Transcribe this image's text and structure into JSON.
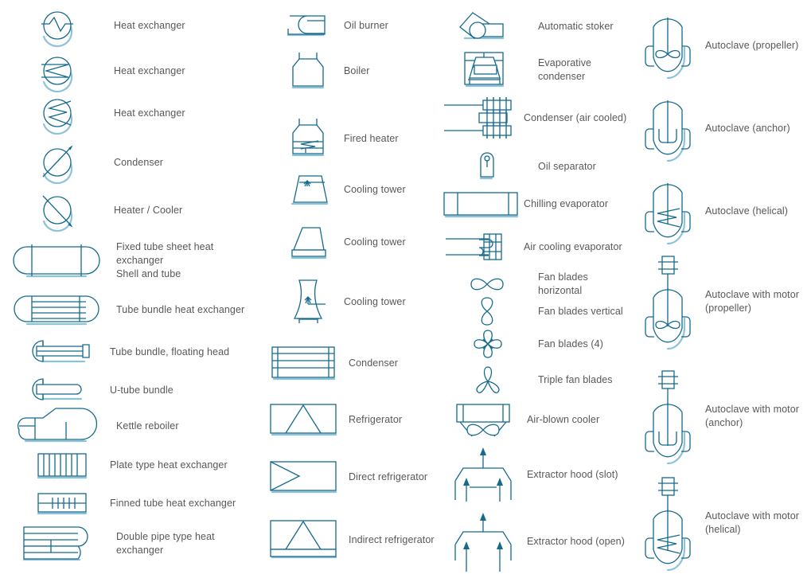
{
  "page": {
    "title": "Chemical and Process Engineering — Heat Exchangers and Vessels stencil",
    "background_color": "#ffffff",
    "symbol_line_color": "#156a8e",
    "symbol_shadow_color": "#8cc3da",
    "label_text_color": "#58585a"
  },
  "columns": [
    {
      "name": "column-heat-exchangers",
      "items": [
        {
          "icon": "heat-exchanger-zigzag-circle-icon",
          "label": "Heat exchanger"
        },
        {
          "icon": "heat-exchanger-arrow-circle-icon",
          "label": "Heat exchanger"
        },
        {
          "icon": "heat-exchanger-coil-circle-icon",
          "label": "Heat exchanger"
        },
        {
          "icon": "condenser-circle-arrow-icon",
          "label": "Condenser"
        },
        {
          "icon": "heater-cooler-circle-arrow-icon",
          "label": "Heater / Cooler"
        },
        {
          "icon": "fixed-tube-sheet-heat-exchanger-icon",
          "label": "Fixed tube sheet heat exchanger\nShell and tube"
        },
        {
          "icon": "tube-bundle-heat-exchanger-icon",
          "label": "Tube bundle heat exchanger"
        },
        {
          "icon": "tube-bundle-floating-head-icon",
          "label": "Tube bundle, floating head"
        },
        {
          "icon": "u-tube-bundle-icon",
          "label": "U-tube bundle"
        },
        {
          "icon": "kettle-reboiler-icon",
          "label": "Kettle reboiler"
        },
        {
          "icon": "plate-type-heat-exchanger-icon",
          "label": "Plate type heat exchanger"
        },
        {
          "icon": "finned-tube-heat-exchanger-icon",
          "label": "Finned tube heat exchanger"
        },
        {
          "icon": "double-pipe-type-heat-exchanger-icon",
          "label": "Double pipe type heat exchanger"
        }
      ]
    },
    {
      "name": "column-boilers-towers",
      "items": [
        {
          "icon": "oil-burner-icon",
          "label": "Oil burner"
        },
        {
          "icon": "boiler-icon",
          "label": "Boiler"
        },
        {
          "icon": "fired-heater-icon",
          "label": "Fired heater"
        },
        {
          "icon": "cooling-tower-trapezoid-icon",
          "label": "Cooling tower"
        },
        {
          "icon": "cooling-tower-base-icon",
          "label": "Cooling tower"
        },
        {
          "icon": "cooling-tower-hyperbolic-icon",
          "label": "Cooling tower"
        },
        {
          "icon": "condenser-box-icon",
          "label": "Condenser"
        },
        {
          "icon": "refrigerator-icon",
          "label": "Refrigerator"
        },
        {
          "icon": "direct-refrigerator-icon",
          "label": "Direct refrigerator"
        },
        {
          "icon": "indirect-refrigerator-icon",
          "label": "Indirect refrigerator"
        }
      ]
    },
    {
      "name": "column-condensers-fans",
      "items": [
        {
          "icon": "automatic-stoker-icon",
          "label": "Automatic stoker"
        },
        {
          "icon": "evaporative-condenser-icon",
          "label": "Evaporative condenser"
        },
        {
          "icon": "condenser-air-cooled-icon",
          "label": "Condenser (air cooled)"
        },
        {
          "icon": "oil-separator-icon",
          "label": "Oil separator"
        },
        {
          "icon": "chilling-evaporator-icon",
          "label": "Chilling evaporator"
        },
        {
          "icon": "air-cooling-evaporator-icon",
          "label": "Air cooling evaporator"
        },
        {
          "icon": "fan-blades-horizontal-icon",
          "label": "Fan blades horizontal"
        },
        {
          "icon": "fan-blades-vertical-icon",
          "label": "Fan blades vertical"
        },
        {
          "icon": "fan-blades-four-icon",
          "label": "Fan blades (4)"
        },
        {
          "icon": "triple-fan-blades-icon",
          "label": "Triple fan blades"
        },
        {
          "icon": "air-blown-cooler-icon",
          "label": "Air-blown cooler"
        },
        {
          "icon": "extractor-hood-slot-icon",
          "label": "Extractor hood (slot)"
        },
        {
          "icon": "extractor-hood-open-icon",
          "label": "Extractor hood (open)"
        }
      ]
    },
    {
      "name": "column-autoclaves",
      "items": [
        {
          "icon": "autoclave-propeller-icon",
          "label": "Autoclave (propeller)"
        },
        {
          "icon": "autoclave-anchor-icon",
          "label": "Autoclave (anchor)"
        },
        {
          "icon": "autoclave-helical-icon",
          "label": "Autoclave (helical)"
        },
        {
          "icon": "autoclave-with-motor-propeller-icon",
          "label": "Autoclave with motor\n(propeller)"
        },
        {
          "icon": "autoclave-with-motor-anchor-icon",
          "label": "Autoclave with motor\n(anchor)"
        },
        {
          "icon": "autoclave-with-motor-helical-icon",
          "label": "Autoclave with motor\n(helical)"
        }
      ]
    }
  ]
}
